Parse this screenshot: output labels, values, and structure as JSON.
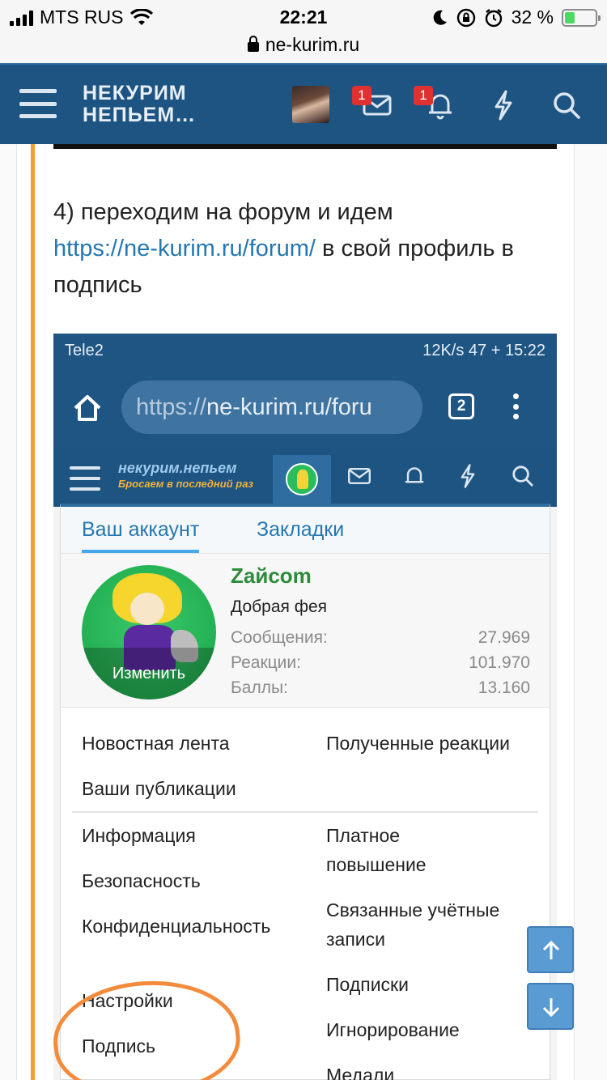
{
  "ios_status": {
    "carrier": "MTS RUS",
    "time": "22:21",
    "battery": "32 %"
  },
  "url": {
    "domain": "ne-kurim.ru"
  },
  "site_header": {
    "logo_line1": "НЕКУРИМ",
    "logo_line2": "НЕПЬЕМ…",
    "messages_badge": "1",
    "alerts_badge": "1"
  },
  "content": {
    "step_prefix": "4) переходим на форум и идем",
    "link": "https://ne-kurim.ru/forum/",
    "step_suffix": " в свой профиль в подпись"
  },
  "screenshot": {
    "status_left": "Tele2",
    "status_right": "12K/s 47 + 15:22",
    "address_scheme": "https://",
    "address_host": "ne-kurim.ru/foru",
    "tabs_count": "2",
    "forum_logo": "некурим.непьем",
    "forum_logo_sub": "Бросаем в последний раз",
    "menu_tabs": [
      {
        "label": "Ваш аккаунт"
      },
      {
        "label": "Закладки"
      }
    ],
    "profile": {
      "name": "Zайcom",
      "title": "Добрая фея",
      "edit": "Изменить",
      "stats": [
        {
          "label": "Сообщения:",
          "value": "27.969"
        },
        {
          "label": "Реакции:",
          "value": "101.970"
        },
        {
          "label": "Баллы:",
          "value": "13.160"
        }
      ]
    },
    "links_group1_left": [
      "Новостная лента",
      "Ваши публикации"
    ],
    "links_group1_right": [
      "Полученные реакции"
    ],
    "links_group2_left": [
      "Информация",
      "Безопасность",
      "Конфиденциальность",
      "Настройки",
      "Подпись"
    ],
    "links_group2_right": [
      "Платное повышение",
      "Связанные учётные записи",
      "Подписки",
      "Игнорирование",
      "Медали"
    ]
  },
  "colors": {
    "header_blue": "#1d5482",
    "link_blue": "#2577b1",
    "accent_orange": "#f0a030",
    "annotation_orange": "#f28c3c",
    "user_green": "#2e8b3a"
  }
}
